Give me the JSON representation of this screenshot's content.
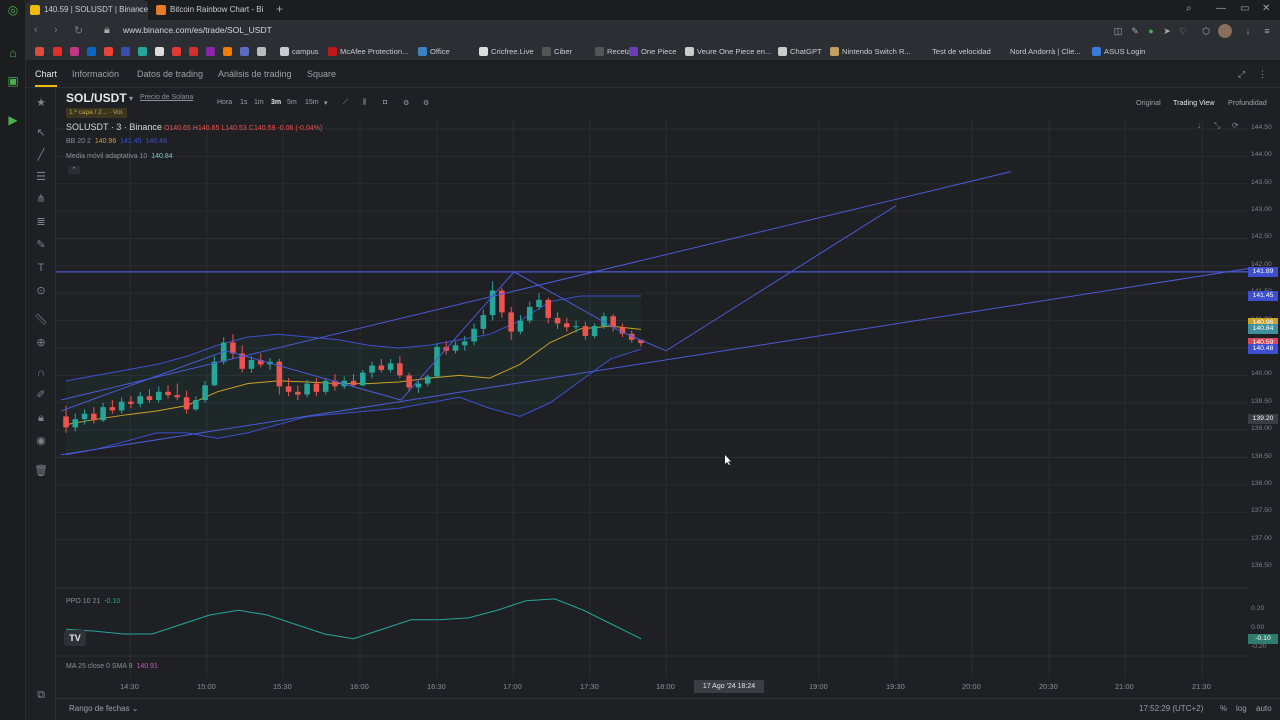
{
  "browser": {
    "tabs": [
      {
        "label": "140.59 | SOLUSDT | Binance"
      },
      {
        "label": "Bitcoin Rainbow Chart - Bi"
      }
    ],
    "url": "www.binance.com/es/trade/SOL_USDT",
    "bookmarks": [
      "campus",
      "McAfee Protection...",
      "Office",
      "Cricfree.Live",
      "Ciber",
      "Recetas",
      "One Piece",
      "Veure One Piece en...",
      "ChatGPT",
      "Nintendo Switch R...",
      "Test de velocidad",
      "Nord Andorrà | Clie...",
      "ASUS Login"
    ]
  },
  "binance_nav": {
    "tabs": [
      "Chart",
      "Información",
      "Datos de trading",
      "Análisis de trading",
      "Square"
    ]
  },
  "toolbar": {
    "pair": "SOL/USDT",
    "pair_subtitle": "Precio de Solana",
    "layers": "1.ª capa / 2...",
    "vol": "Vol.",
    "timeframes": [
      "Hora",
      "1s",
      "1m",
      "3m",
      "5m",
      "15m"
    ],
    "selected_timeframe": "3m",
    "views": [
      "Original",
      "Trading View",
      "Profundidad"
    ],
    "selected_view": "Trading View"
  },
  "legend": {
    "symbol_line": "SOLUSDT · 3 · Binance",
    "ohlc": {
      "o": "O140.65",
      "h": "H140.65",
      "l": "L140.53",
      "c": "C140.59",
      "chg": "-0.06 (-0.04%)"
    },
    "bb_label": "BB 20 2",
    "bb_values": [
      "140.96",
      "141.45",
      "140.48"
    ],
    "ama_label": "Media móvil adaptativa 10",
    "ama_value": "140.84",
    "ppo_label": "PPO 10 21",
    "ppo_value": "-0.10",
    "ma_label": "MA 25 close 0 SMA 9",
    "ma_value": "140.91"
  },
  "price_axis": {
    "ticks": [
      "144.50",
      "144.00",
      "143.50",
      "143.00",
      "142.50",
      "142.00",
      "141.50",
      "141.00",
      "140.50",
      "140.00",
      "139.50",
      "139.00",
      "138.50",
      "138.00",
      "137.50",
      "137.00",
      "136.50"
    ],
    "labels": [
      {
        "text": "141.89",
        "color": "#3d4fd1"
      },
      {
        "text": "141.45",
        "color": "#3d4fd1"
      },
      {
        "text": "140.96",
        "color": "#c9a227"
      },
      {
        "text": "140.84",
        "color": "#3f8f9c"
      },
      {
        "text": "140.59",
        "color": "#d64b5b"
      },
      {
        "text": "140.48",
        "color": "#3d4fd1"
      },
      {
        "text": "139.20",
        "color": "#3a3e44"
      }
    ],
    "ppo_ticks": [
      "0.20",
      "0.00",
      "-0.20"
    ],
    "ppo_label": "-0.10"
  },
  "time_axis": {
    "ticks": [
      "14:30",
      "15:00",
      "15:30",
      "16:00",
      "16:30",
      "17:00",
      "17:30",
      "18:00",
      "19:00",
      "19:30",
      "20:00",
      "20:30",
      "21:00",
      "21:30"
    ],
    "crosshair": "17 Ago '24   18:24"
  },
  "bottom": {
    "range_label": "Rango de fechas",
    "clock": "17:52:29 (UTC+2)",
    "percent": "%",
    "log": "log",
    "auto": "auto"
  },
  "colors": {
    "up": "#26a69a",
    "down": "#ef5350",
    "bb": "#3d4fd1",
    "ama": "#c9a227",
    "ppo": "#26a69a",
    "accent": "#f0b90b"
  },
  "chart_data": {
    "type": "candlestick",
    "symbol": "SOLUSDT",
    "interval": "3m",
    "candles": [
      {
        "o": 139.25,
        "h": 139.45,
        "l": 138.95,
        "c": 139.05
      },
      {
        "o": 139.05,
        "h": 139.3,
        "l": 138.98,
        "c": 139.2
      },
      {
        "o": 139.2,
        "h": 139.38,
        "l": 139.1,
        "c": 139.3
      },
      {
        "o": 139.3,
        "h": 139.42,
        "l": 139.12,
        "c": 139.18
      },
      {
        "o": 139.18,
        "h": 139.5,
        "l": 139.15,
        "c": 139.42
      },
      {
        "o": 139.42,
        "h": 139.55,
        "l": 139.3,
        "c": 139.36
      },
      {
        "o": 139.36,
        "h": 139.6,
        "l": 139.3,
        "c": 139.52
      },
      {
        "o": 139.52,
        "h": 139.62,
        "l": 139.4,
        "c": 139.48
      },
      {
        "o": 139.48,
        "h": 139.7,
        "l": 139.42,
        "c": 139.62
      },
      {
        "o": 139.62,
        "h": 139.75,
        "l": 139.5,
        "c": 139.55
      },
      {
        "o": 139.55,
        "h": 139.8,
        "l": 139.5,
        "c": 139.7
      },
      {
        "o": 139.7,
        "h": 139.82,
        "l": 139.58,
        "c": 139.64
      },
      {
        "o": 139.64,
        "h": 139.85,
        "l": 139.55,
        "c": 139.6
      },
      {
        "o": 139.6,
        "h": 139.72,
        "l": 139.3,
        "c": 139.38
      },
      {
        "o": 139.38,
        "h": 139.62,
        "l": 139.35,
        "c": 139.55
      },
      {
        "o": 139.55,
        "h": 139.9,
        "l": 139.5,
        "c": 139.82
      },
      {
        "o": 139.82,
        "h": 140.35,
        "l": 139.8,
        "c": 140.25
      },
      {
        "o": 140.25,
        "h": 140.7,
        "l": 140.2,
        "c": 140.6
      },
      {
        "o": 140.6,
        "h": 140.75,
        "l": 140.3,
        "c": 140.4
      },
      {
        "o": 140.4,
        "h": 140.55,
        "l": 140.05,
        "c": 140.12
      },
      {
        "o": 140.12,
        "h": 140.35,
        "l": 140.05,
        "c": 140.28
      },
      {
        "o": 140.28,
        "h": 140.4,
        "l": 140.15,
        "c": 140.2
      },
      {
        "o": 140.2,
        "h": 140.32,
        "l": 140.1,
        "c": 140.25
      },
      {
        "o": 140.25,
        "h": 140.3,
        "l": 139.65,
        "c": 139.8
      },
      {
        "o": 139.8,
        "h": 139.95,
        "l": 139.62,
        "c": 139.7
      },
      {
        "o": 139.7,
        "h": 139.82,
        "l": 139.55,
        "c": 139.65
      },
      {
        "o": 139.65,
        "h": 139.92,
        "l": 139.6,
        "c": 139.85
      },
      {
        "o": 139.85,
        "h": 139.95,
        "l": 139.62,
        "c": 139.7
      },
      {
        "o": 139.7,
        "h": 139.95,
        "l": 139.65,
        "c": 139.9
      },
      {
        "o": 139.9,
        "h": 140.02,
        "l": 139.72,
        "c": 139.8
      },
      {
        "o": 139.8,
        "h": 139.98,
        "l": 139.75,
        "c": 139.9
      },
      {
        "o": 139.9,
        "h": 140.02,
        "l": 139.78,
        "c": 139.82
      },
      {
        "o": 139.82,
        "h": 140.1,
        "l": 139.8,
        "c": 140.05
      },
      {
        "o": 140.05,
        "h": 140.25,
        "l": 139.95,
        "c": 140.18
      },
      {
        "o": 140.18,
        "h": 140.3,
        "l": 140.05,
        "c": 140.1
      },
      {
        "o": 140.1,
        "h": 140.3,
        "l": 140.05,
        "c": 140.22
      },
      {
        "o": 140.22,
        "h": 140.35,
        "l": 139.95,
        "c": 140.0
      },
      {
        "o": 140.0,
        "h": 140.05,
        "l": 139.7,
        "c": 139.78
      },
      {
        "o": 139.78,
        "h": 139.9,
        "l": 139.68,
        "c": 139.85
      },
      {
        "o": 139.85,
        "h": 140.02,
        "l": 139.8,
        "c": 139.98
      },
      {
        "o": 139.98,
        "h": 140.58,
        "l": 139.95,
        "c": 140.52
      },
      {
        "o": 140.52,
        "h": 140.62,
        "l": 140.38,
        "c": 140.45
      },
      {
        "o": 140.45,
        "h": 140.62,
        "l": 140.4,
        "c": 140.55
      },
      {
        "o": 140.55,
        "h": 140.72,
        "l": 140.45,
        "c": 140.62
      },
      {
        "o": 140.62,
        "h": 140.95,
        "l": 140.55,
        "c": 140.85
      },
      {
        "o": 140.85,
        "h": 141.2,
        "l": 140.75,
        "c": 141.1
      },
      {
        "o": 141.1,
        "h": 141.72,
        "l": 141.0,
        "c": 141.55
      },
      {
        "o": 141.55,
        "h": 141.6,
        "l": 141.05,
        "c": 141.15
      },
      {
        "o": 141.15,
        "h": 141.25,
        "l": 140.65,
        "c": 140.8
      },
      {
        "o": 140.8,
        "h": 141.1,
        "l": 140.75,
        "c": 141.0
      },
      {
        "o": 141.0,
        "h": 141.35,
        "l": 140.95,
        "c": 141.25
      },
      {
        "o": 141.25,
        "h": 141.5,
        "l": 141.2,
        "c": 141.38
      },
      {
        "o": 141.38,
        "h": 141.42,
        "l": 140.95,
        "c": 141.05
      },
      {
        "o": 141.05,
        "h": 141.15,
        "l": 140.85,
        "c": 140.95
      },
      {
        "o": 140.95,
        "h": 141.05,
        "l": 140.8,
        "c": 140.88
      },
      {
        "o": 140.88,
        "h": 141.0,
        "l": 140.78,
        "c": 140.9
      },
      {
        "o": 140.9,
        "h": 140.98,
        "l": 140.65,
        "c": 140.72
      },
      {
        "o": 140.72,
        "h": 140.95,
        "l": 140.68,
        "c": 140.9
      },
      {
        "o": 140.9,
        "h": 141.15,
        "l": 140.85,
        "c": 141.08
      },
      {
        "o": 141.08,
        "h": 141.12,
        "l": 140.8,
        "c": 140.88
      },
      {
        "o": 140.88,
        "h": 140.95,
        "l": 140.7,
        "c": 140.76
      },
      {
        "o": 140.76,
        "h": 140.82,
        "l": 140.6,
        "c": 140.65
      },
      {
        "o": 140.65,
        "h": 140.65,
        "l": 140.53,
        "c": 140.59
      }
    ],
    "bb_upper": [
      139.9,
      140.0,
      140.1,
      140.2,
      140.35,
      140.55,
      140.7,
      140.75,
      140.7,
      140.65,
      140.55,
      140.5,
      140.55,
      140.65,
      140.75,
      141.0,
      141.35,
      141.45,
      141.45,
      141.45
    ],
    "bb_lower": [
      138.55,
      138.65,
      138.8,
      138.95,
      138.95,
      138.85,
      138.95,
      139.1,
      139.25,
      139.3,
      139.35,
      139.4,
      139.5,
      139.6,
      139.4,
      139.25,
      139.5,
      139.9,
      140.3,
      140.48
    ],
    "ama": [
      139.1,
      139.2,
      139.28,
      139.35,
      139.45,
      139.7,
      139.85,
      139.9,
      139.88,
      139.85,
      139.85,
      139.88,
      139.95,
      140.0,
      139.95,
      140.2,
      140.6,
      140.85,
      140.9,
      140.84
    ],
    "ppo": [
      0.0,
      -0.02,
      -0.05,
      -0.05,
      0.05,
      0.15,
      0.2,
      0.15,
      0.05,
      -0.05,
      -0.1,
      0.0,
      0.1,
      0.1,
      0.12,
      0.2,
      0.3,
      0.32,
      0.2,
      0.05,
      -0.1
    ],
    "drawings": {
      "upper_channel": [
        [
          139.55,
          0
        ],
        [
          143.72,
          1
        ]
      ],
      "lower_channel": [
        [
          138.55,
          0
        ],
        [
          141.95,
          1
        ]
      ],
      "horizontal": 141.89
    },
    "ylim": [
      136.3,
      144.7
    ]
  }
}
